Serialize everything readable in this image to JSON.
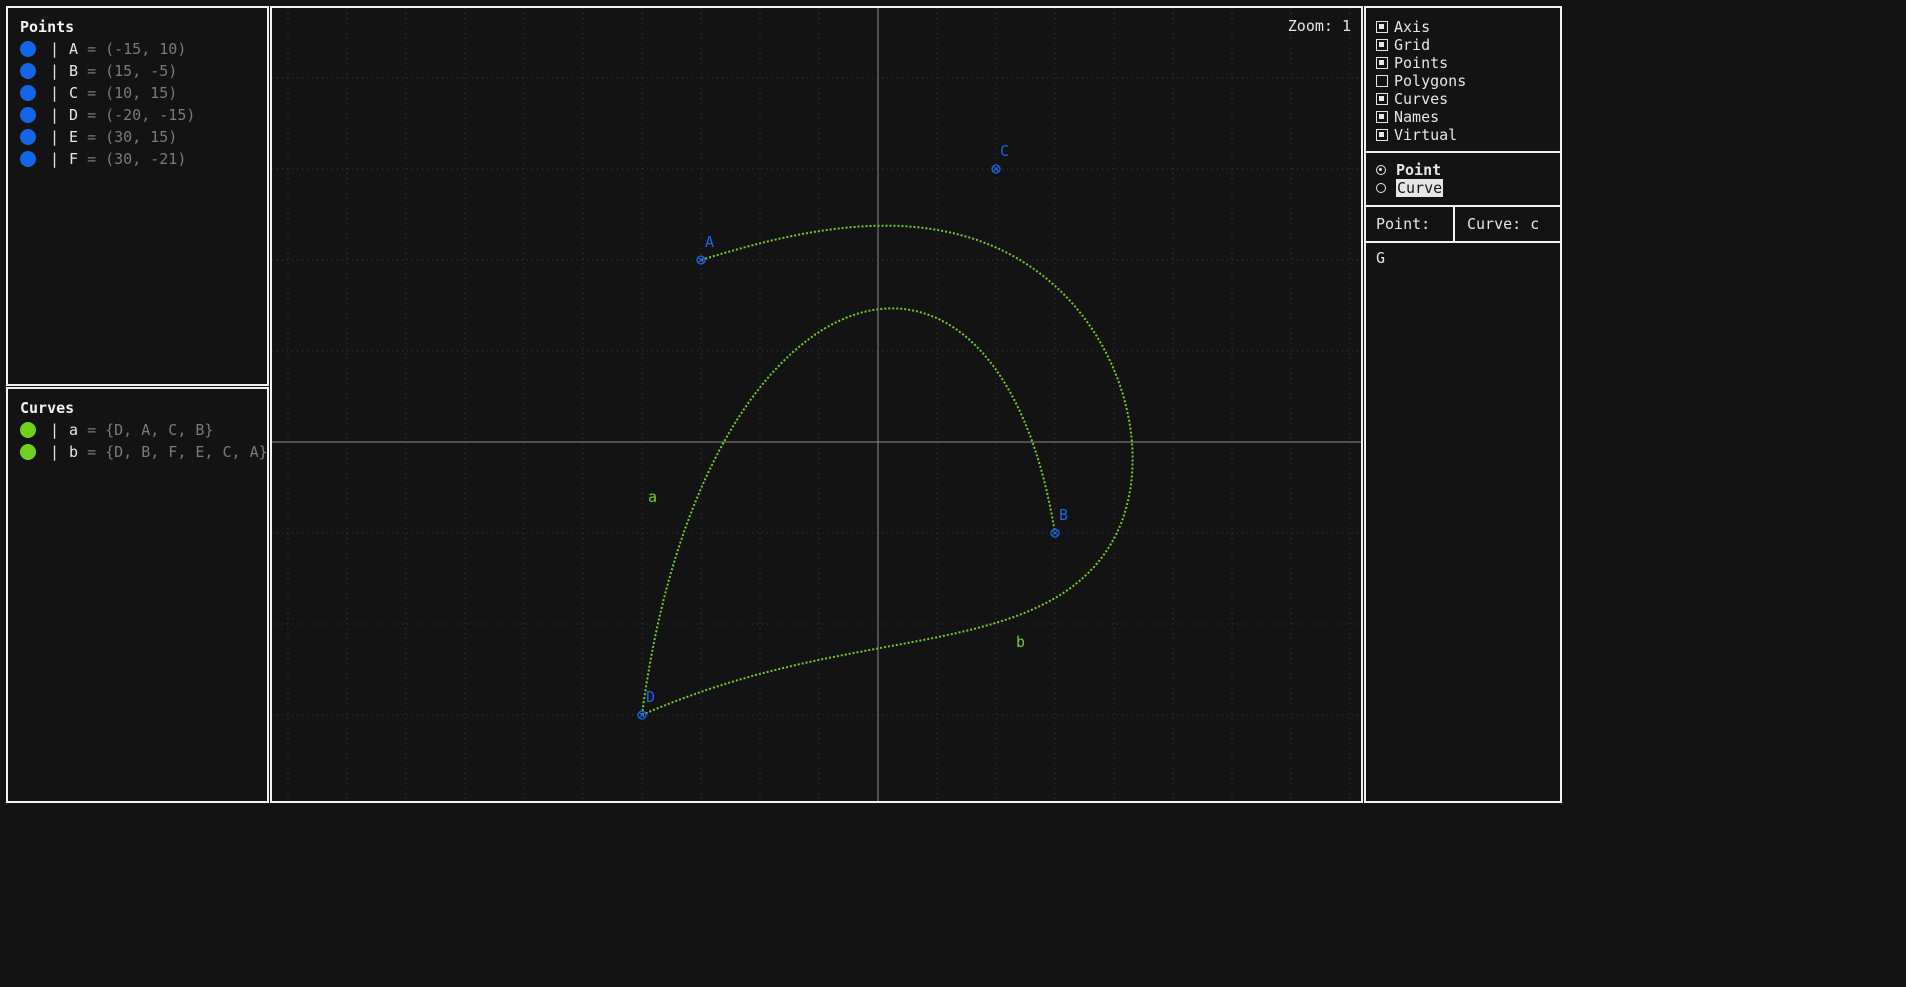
{
  "points_panel": {
    "title": "Points",
    "items": [
      {
        "name": "A",
        "value": "(-15, 10)"
      },
      {
        "name": "B",
        "value": "(15, -5)"
      },
      {
        "name": "C",
        "value": "(10, 15)"
      },
      {
        "name": "D",
        "value": "(-20, -15)"
      },
      {
        "name": "E",
        "value": "(30, 15)"
      },
      {
        "name": "F",
        "value": "(30, -21)"
      }
    ]
  },
  "curves_panel": {
    "title": "Curves",
    "items": [
      {
        "name": "a",
        "value": "{D, A, C, B}"
      },
      {
        "name": "b",
        "value": "{D, B, F, E, C, A}"
      }
    ]
  },
  "canvas": {
    "zoom_label": "Zoom: 1",
    "point_labels": [
      "A",
      "B",
      "C",
      "D"
    ],
    "curve_labels": [
      "a",
      "b"
    ]
  },
  "display_options": [
    {
      "label": "Axis",
      "checked": true
    },
    {
      "label": "Grid",
      "checked": true
    },
    {
      "label": "Points",
      "checked": true
    },
    {
      "label": "Polygons",
      "checked": false
    },
    {
      "label": "Curves",
      "checked": true
    },
    {
      "label": "Names",
      "checked": true
    },
    {
      "label": "Virtual",
      "checked": true
    }
  ],
  "mode": {
    "options": [
      {
        "label": "Point",
        "selected": true
      },
      {
        "label": "Curve",
        "selected": false,
        "highlighted": true
      }
    ]
  },
  "status": {
    "point": "Point: G",
    "curve": "Curve: c"
  },
  "colors": {
    "background": "#131313",
    "border": "#f2f2f2",
    "point": "#1565e6",
    "curve": "#6fd01e",
    "axis": "#8a8a8a",
    "grid": "#3a3a3a",
    "muted_text": "#7a7a7a"
  }
}
